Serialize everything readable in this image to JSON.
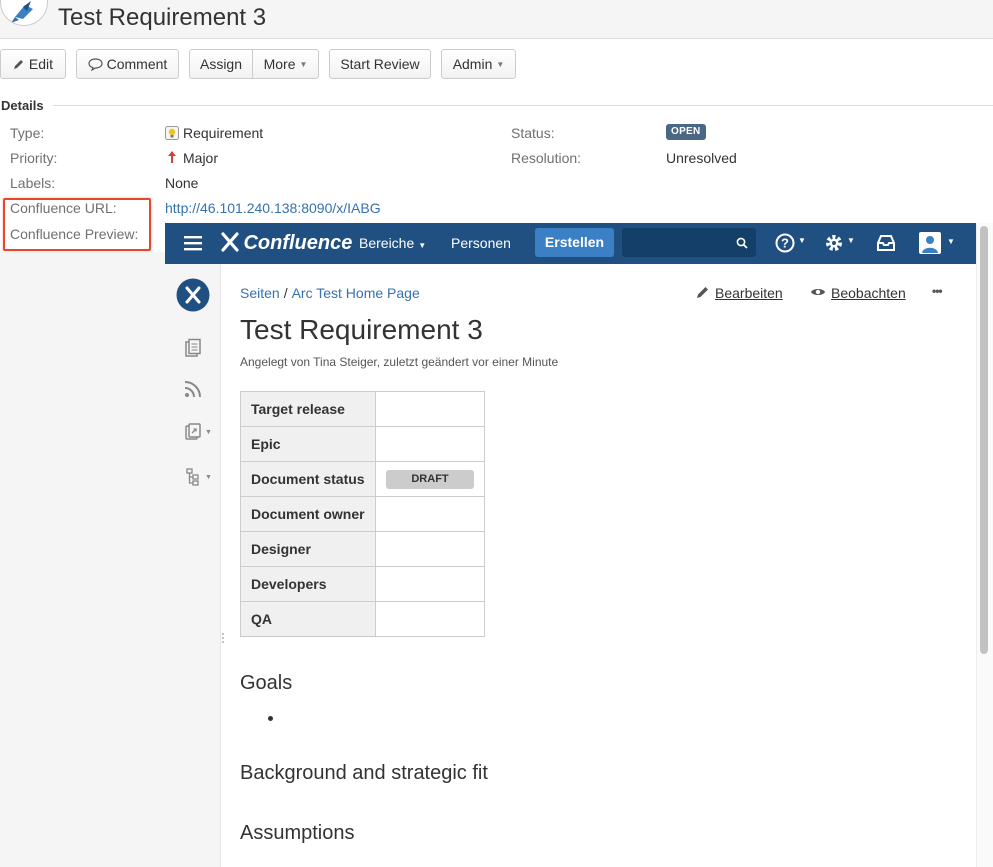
{
  "issue": {
    "title": "Test Requirement 3"
  },
  "toolbar": {
    "edit": "Edit",
    "comment": "Comment",
    "assign": "Assign",
    "more": "More",
    "start_review": "Start Review",
    "admin": "Admin"
  },
  "details": {
    "heading": "Details",
    "type_label": "Type:",
    "type_value": "Requirement",
    "priority_label": "Priority:",
    "priority_value": "Major",
    "labels_label": "Labels:",
    "labels_value": "None",
    "confluence_url_label": "Confluence URL:",
    "confluence_url_value": "http://46.101.240.138:8090/x/IABG",
    "confluence_preview_label": "Confluence Preview:",
    "status_label": "Status:",
    "status_value": "OPEN",
    "resolution_label": "Resolution:",
    "resolution_value": "Unresolved"
  },
  "confluence": {
    "logo": "Confluence",
    "nav_spaces": "Bereiche",
    "nav_people": "Personen",
    "create": "Erstellen",
    "search_placeholder": "",
    "breadcrumb_root": "Seiten",
    "breadcrumb_sep": "/",
    "breadcrumb_parent": "Arc Test Home Page",
    "action_edit": "Bearbeiten",
    "action_watch": "Beobachten",
    "more": "•••",
    "page_title": "Test Requirement 3",
    "byline": "Angelegt von Tina Steiger, zuletzt geändert vor einer Minute",
    "table": [
      {
        "key": "Target release",
        "value": ""
      },
      {
        "key": "Epic",
        "value": ""
      },
      {
        "key": "Document status",
        "value": "DRAFT"
      },
      {
        "key": "Document owner",
        "value": ""
      },
      {
        "key": "Designer",
        "value": ""
      },
      {
        "key": "Developers",
        "value": ""
      },
      {
        "key": "QA",
        "value": ""
      }
    ],
    "heading_goals": "Goals",
    "heading_background": "Background and strategic fit",
    "heading_assumptions": "Assumptions"
  },
  "colors": {
    "confluence_blue": "#205081",
    "create_blue": "#3b7fc4",
    "link_blue": "#3572b0",
    "status_badge": "#4a6785",
    "highlight_red": "#e8472b"
  }
}
